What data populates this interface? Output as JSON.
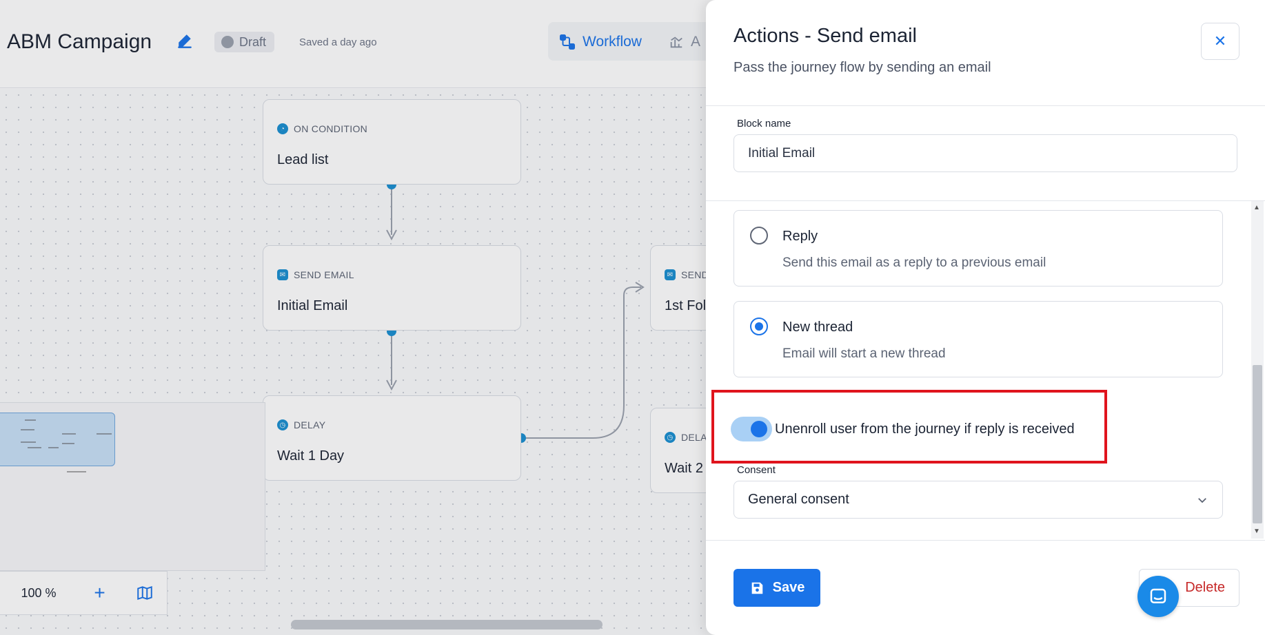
{
  "header": {
    "title": "ABM Campaign",
    "status": "Draft",
    "saved_text": "Saved a day ago",
    "tabs": [
      {
        "label": "Workflow",
        "icon": "workflow-icon",
        "active": true
      },
      {
        "label": "A",
        "icon": "analytics-icon",
        "active": false
      }
    ]
  },
  "canvas": {
    "nodes": [
      {
        "type": "ON CONDITION",
        "title": "Lead list",
        "icon": "condition-icon"
      },
      {
        "type": "SEND EMAIL",
        "title": "Initial Email",
        "icon": "mail-icon"
      },
      {
        "type": "DELAY",
        "title": "Wait 1 Day",
        "icon": "clock-icon"
      },
      {
        "type": "SEND",
        "title": "1st Fol",
        "icon": "mail-icon"
      },
      {
        "type": "DELA",
        "title": "Wait 2",
        "icon": "clock-icon"
      }
    ],
    "zoom_level": "100 %"
  },
  "panel": {
    "title": "Actions - Send email",
    "subtitle": "Pass the journey flow by sending an email",
    "block_name_label": "Block name",
    "block_name_value": "Initial Email",
    "thread_options": [
      {
        "label": "Reply",
        "description": "Send this email as a reply to a previous email",
        "checked": false
      },
      {
        "label": "New thread",
        "description": "Email will start a new thread",
        "checked": true
      }
    ],
    "unenroll_toggle": {
      "label": "Unenroll user from the journey if reply is received",
      "on": true
    },
    "consent_label": "Consent",
    "consent_value": "General consent",
    "save_label": "Save",
    "delete_label": "Delete"
  },
  "colors": {
    "accent": "#1a73e8",
    "highlight": "#e0141d",
    "danger": "#c62828"
  }
}
